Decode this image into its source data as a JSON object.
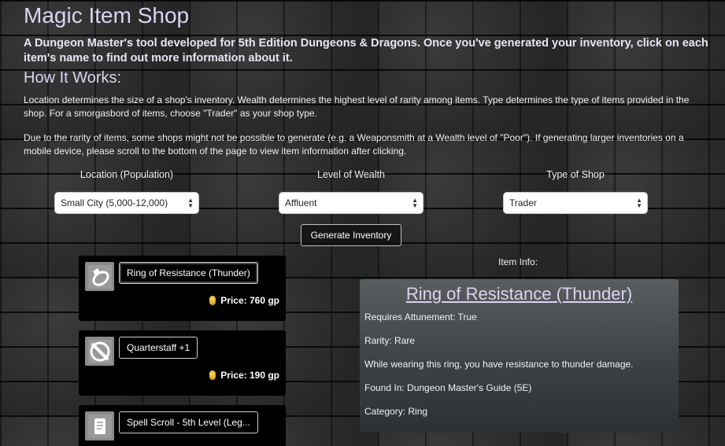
{
  "header": {
    "title": "Magic Item Shop",
    "intro": "A Dungeon Master's tool developed for 5th Edition Dungeons & Dragons. Once you've generated your inventory, click on each item's name to find out more information about it."
  },
  "how_it_works": {
    "heading": "How It Works:",
    "paragraph_1": "Location determines the size of a shop's inventory. Wealth determines the highest level of rarity among items. Type determines the type of items provided in the shop. For a smorgasbord of items, choose \"Trader\" as your shop type.",
    "paragraph_2": "Due to the rarity of items, some shops might not be possible to generate (e.g. a Weaponsmith at a Wealth level of \"Poor\"). If generating larger inventories on a mobile device, please scroll to the bottom of the page to view item information after clicking."
  },
  "controls": {
    "location": {
      "label": "Location (Population)",
      "value": "Small City (5,000-12,000)"
    },
    "wealth": {
      "label": "Level of Wealth",
      "value": "Affluent"
    },
    "shop_type": {
      "label": "Type of Shop",
      "value": "Trader"
    },
    "generate_label": "Generate Inventory"
  },
  "items": [
    {
      "name": "Ring of Resistance (Thunder)",
      "price": "Price: 760 gp",
      "icon": "ring-icon"
    },
    {
      "name": "Quarterstaff +1",
      "price": "Price: 190 gp",
      "icon": "staff-icon"
    },
    {
      "name": "Spell Scroll - 5th Level (Leg...",
      "price": "",
      "icon": "scroll-icon"
    }
  ],
  "item_info": {
    "label": "Item Info:",
    "title": "Ring of Resistance (Thunder)",
    "attunement": "Requires Attunement: True",
    "rarity": "Rarity: Rare",
    "description": "While wearing this ring, you have resistance to thunder damage.",
    "found_in": "Found In: Dungeon Master's Guide (5E)",
    "category": "Category: Ring"
  },
  "colors": {
    "accent": "#dcd3f2",
    "coin": "#e8a317",
    "panel": "#4a4e50"
  }
}
